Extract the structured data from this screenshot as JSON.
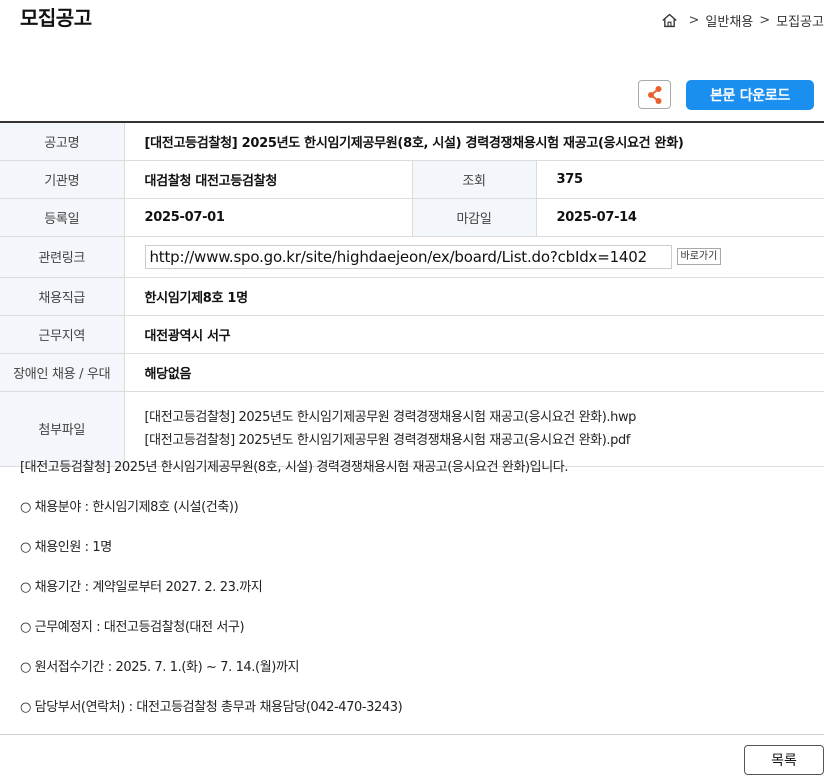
{
  "header": {
    "title": "모집공고",
    "breadcrumb": [
      ">",
      "일반채용",
      ">",
      "모집공고"
    ]
  },
  "toolbar": {
    "download_label": "본문 다운로드",
    "share_icon": "share-icon"
  },
  "table": {
    "labels": {
      "title": "공고명",
      "agency": "기관명",
      "views": "조회",
      "registered": "등록일",
      "deadline": "마감일",
      "link": "관련링크",
      "position": "채용직급",
      "location": "근무지역",
      "disability": "장애인 채용 / 우대",
      "attachments": "첨부파일"
    },
    "values": {
      "title": "[대전고등검찰청] 2025년도 한시임기제공무원(8호, 시설) 경력경쟁채용시험 재공고(응시요건 완화)",
      "agency": "대검찰청 대전고등검찰청",
      "views": "375",
      "registered": "2025-07-01",
      "deadline": "2025-07-14",
      "link": "http://www.spo.go.kr/site/highdaejeon/ex/board/List.do?cbIdx=1402",
      "link_button": "바로가기",
      "position": "한시임기제8호 1명",
      "location": "대전광역시 서구",
      "disability": "해당없음",
      "files": [
        "[대전고등검찰청] 2025년도 한시임기제공무원 경력경쟁채용시험 재공고(응시요건 완화).hwp",
        "[대전고등검찰청] 2025년도 한시임기제공무원 경력경쟁채용시험 재공고(응시요건 완화).pdf"
      ]
    }
  },
  "content": {
    "paragraphs": [
      "[대전고등검찰청] 2025년 한시임기제공무원(8호, 시설) 경력경쟁채용시험 재공고(응시요건 완화)입니다.",
      "○ 채용분야 : 한시임기제8호 (시설(건축))",
      "○ 채용인원 : 1명",
      "○ 채용기간 : 계약일로부터 2027. 2. 23.까지",
      "○ 근무예정지 : 대전고등검찰청(대전 서구)",
      "○ 원서접수기간 : 2025. 7. 1.(화) ~ 7. 14.(월)까지",
      "○ 담당부서(연락처) : 대전고등검찰청 총무과 채용담당(042-470-3243)"
    ]
  },
  "footer": {
    "list_label": "목록"
  },
  "colors": {
    "accent": "#1a8ff0",
    "share": "#e8602c",
    "label_bg": "#f3f6fa"
  }
}
